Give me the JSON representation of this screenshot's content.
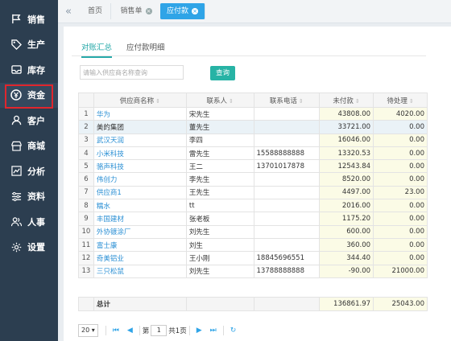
{
  "sidebar": {
    "items": [
      {
        "label": "销售",
        "icon": "flag-icon"
      },
      {
        "label": "生产",
        "icon": "tag-icon"
      },
      {
        "label": "库存",
        "icon": "inbox-icon"
      },
      {
        "label": "资金",
        "icon": "coin-icon",
        "active": true
      },
      {
        "label": "客户",
        "icon": "user-icon"
      },
      {
        "label": "商城",
        "icon": "store-icon"
      },
      {
        "label": "分析",
        "icon": "chart-icon"
      },
      {
        "label": "资料",
        "icon": "sliders-icon"
      },
      {
        "label": "人事",
        "icon": "people-icon"
      },
      {
        "label": "设置",
        "icon": "gear-icon"
      }
    ]
  },
  "topbar": {
    "tabs": [
      {
        "label": "首页"
      },
      {
        "label": "销售单"
      },
      {
        "label": "应付款"
      }
    ]
  },
  "subtabs": [
    {
      "label": "对账汇总"
    },
    {
      "label": "应付款明细"
    }
  ],
  "search": {
    "placeholder": "请输入供应商名称查询",
    "value": ""
  },
  "query_button": "查询",
  "table": {
    "columns": [
      "供应商名称",
      "联系人",
      "联系电话",
      "未付款",
      "待处理"
    ],
    "rows": [
      {
        "idx": "1",
        "name": "华为",
        "contact": "宋先生",
        "phone": "",
        "unpaid": "43808.00",
        "pending": "4020.00"
      },
      {
        "idx": "2",
        "name": "美的集团",
        "contact": "董先生",
        "phone": "",
        "unpaid": "33721.00",
        "pending": "0.00"
      },
      {
        "idx": "3",
        "name": "武汉天润",
        "contact": "李四",
        "phone": "",
        "unpaid": "16046.00",
        "pending": "0.00"
      },
      {
        "idx": "4",
        "name": "小米科技",
        "contact": "雷先生",
        "phone": "15588888888",
        "unpaid": "13320.53",
        "pending": "0.00"
      },
      {
        "idx": "5",
        "name": "骆声科技",
        "contact": "王二",
        "phone": "13701017878",
        "unpaid": "12543.84",
        "pending": "0.00"
      },
      {
        "idx": "6",
        "name": "伟创力",
        "contact": "李先生",
        "phone": "",
        "unpaid": "8520.00",
        "pending": "0.00"
      },
      {
        "idx": "7",
        "name": "供应商1",
        "contact": "王先生",
        "phone": "",
        "unpaid": "4497.00",
        "pending": "23.00"
      },
      {
        "idx": "8",
        "name": "糯水",
        "contact": "tt",
        "phone": "",
        "unpaid": "2016.00",
        "pending": "0.00"
      },
      {
        "idx": "9",
        "name": "丰国建材",
        "contact": "张老板",
        "phone": "",
        "unpaid": "1175.20",
        "pending": "0.00"
      },
      {
        "idx": "10",
        "name": "外协镀涂厂",
        "contact": "刘先生",
        "phone": "",
        "unpaid": "600.00",
        "pending": "0.00"
      },
      {
        "idx": "11",
        "name": "富士康",
        "contact": "刘生",
        "phone": "",
        "unpaid": "360.00",
        "pending": "0.00"
      },
      {
        "idx": "12",
        "name": "奇美铝业",
        "contact": "王小刚",
        "phone": "18845696551",
        "unpaid": "344.40",
        "pending": "0.00"
      },
      {
        "idx": "13",
        "name": "三只松鼠",
        "contact": "刘先生",
        "phone": "13788888888",
        "unpaid": "-90.00",
        "pending": "21000.00"
      }
    ],
    "total": {
      "label": "总计",
      "unpaid": "136861.97",
      "pending": "25043.00"
    }
  },
  "pager": {
    "page_size": "20",
    "page_prefix": "第",
    "page": "1",
    "page_suffix": "共1页"
  },
  "colors": {
    "sidebar": "#2c3e50",
    "accent": "#2fa4e7",
    "teal": "#27b3a5",
    "highlight": "#e0262d"
  }
}
